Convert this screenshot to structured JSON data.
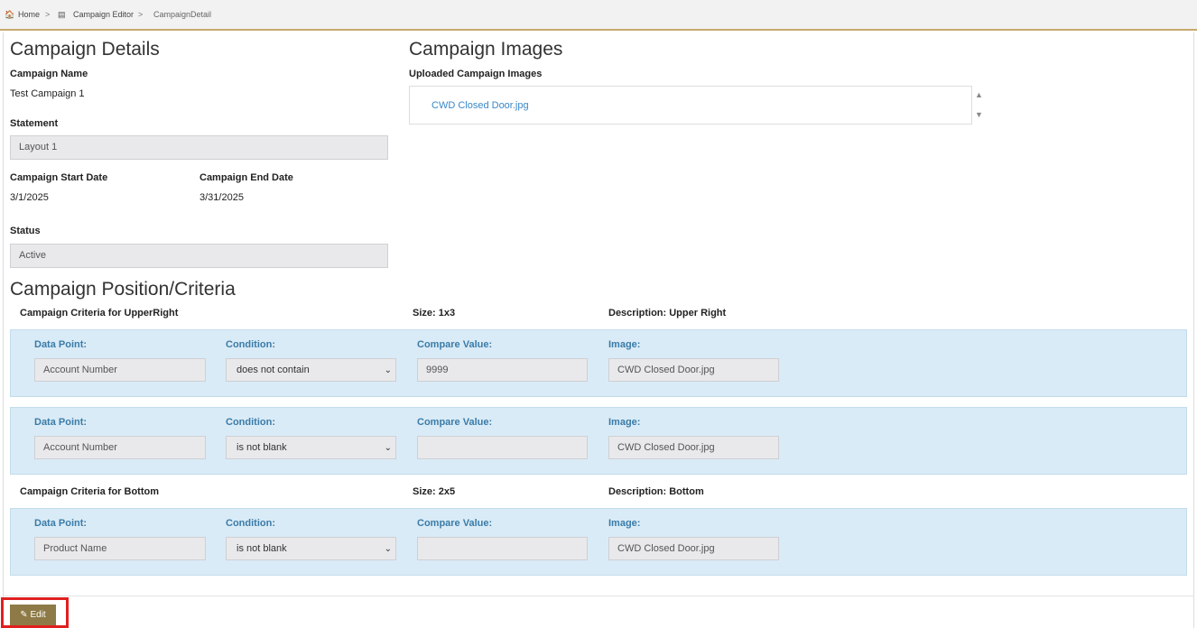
{
  "breadcrumb": {
    "home": "Home",
    "sep1": ">",
    "campaign_editor": "Campaign Editor",
    "sep2": ">",
    "current": "CampaignDetail"
  },
  "details": {
    "heading": "Campaign Details",
    "name_label": "Campaign Name",
    "name_value": "Test Campaign 1",
    "statement_label": "Statement",
    "statement_value": "Layout 1",
    "start_label": "Campaign Start Date",
    "start_value": "3/1/2025",
    "end_label": "Campaign End Date",
    "end_value": "3/31/2025",
    "status_label": "Status",
    "status_value": "Active"
  },
  "images": {
    "heading": "Campaign Images",
    "uploaded_label": "Uploaded Campaign Images",
    "files": [
      "CWD Closed Door.jpg"
    ]
  },
  "criteria": {
    "heading": "Campaign Position/Criteria",
    "labels": {
      "data_point": "Data Point:",
      "condition": "Condition:",
      "compare": "Compare Value:",
      "image": "Image:"
    },
    "groups": [
      {
        "title": "Campaign Criteria for UpperRight",
        "size": "Size: 1x3",
        "description": "Description: Upper Right",
        "rows": [
          {
            "data_point": "Account Number",
            "condition": "does not contain",
            "compare": "9999",
            "image": "CWD Closed Door.jpg"
          },
          {
            "data_point": "Account Number",
            "condition": "is not blank",
            "compare": "",
            "image": "CWD Closed Door.jpg"
          }
        ]
      },
      {
        "title": "Campaign Criteria for Bottom",
        "size": "Size: 2x5",
        "description": "Description: Bottom",
        "rows": [
          {
            "data_point": "Product Name",
            "condition": "is not blank",
            "compare": "",
            "image": "CWD Closed Door.jpg"
          }
        ]
      }
    ]
  },
  "actions": {
    "edit_label": "Edit"
  },
  "colors": {
    "accent": "#c8a96e",
    "panel_bg": "#d9ebf6",
    "label_blue": "#3a7ba8",
    "link": "#3a87c8",
    "edit_bg": "#8e7a46",
    "highlight": "#e02020"
  }
}
